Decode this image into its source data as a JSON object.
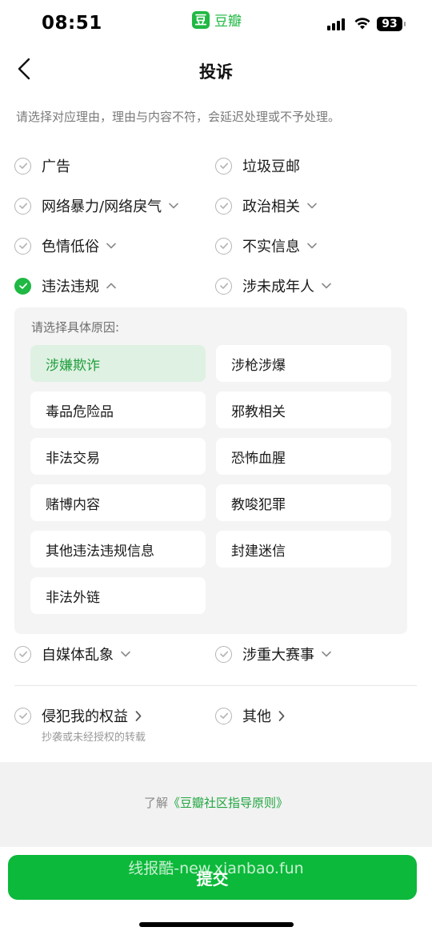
{
  "status_bar": {
    "time": "08:51",
    "app_logo": "豆",
    "app_name": "豆瓣",
    "battery": "93"
  },
  "header": {
    "title": "投诉"
  },
  "instruction": "请选择对应理由，理由与内容不符，会延迟处理或不予处理。",
  "reasons": [
    {
      "label": "广告",
      "checked": false,
      "arrow": "none"
    },
    {
      "label": "垃圾豆邮",
      "checked": false,
      "arrow": "none"
    },
    {
      "label": "网络暴力/网络戾气",
      "checked": false,
      "arrow": "down"
    },
    {
      "label": "政治相关",
      "checked": false,
      "arrow": "down"
    },
    {
      "label": "色情低俗",
      "checked": false,
      "arrow": "down"
    },
    {
      "label": "不实信息",
      "checked": false,
      "arrow": "down"
    },
    {
      "label": "违法违规",
      "checked": true,
      "arrow": "up"
    },
    {
      "label": "涉未成年人",
      "checked": false,
      "arrow": "down"
    },
    {
      "label": "自媒体乱象",
      "checked": false,
      "arrow": "down"
    },
    {
      "label": "涉重大赛事",
      "checked": false,
      "arrow": "down"
    },
    {
      "label": "侵犯我的权益",
      "checked": false,
      "arrow": "right"
    },
    {
      "label": "其他",
      "checked": false,
      "arrow": "right"
    }
  ],
  "sub_reasons": {
    "title": "请选择具体原因:",
    "items": [
      {
        "label": "涉嫌欺诈",
        "selected": true
      },
      {
        "label": "涉枪涉爆",
        "selected": false
      },
      {
        "label": "毒品危险品",
        "selected": false
      },
      {
        "label": "邪教相关",
        "selected": false
      },
      {
        "label": "非法交易",
        "selected": false
      },
      {
        "label": "恐怖血腥",
        "selected": false
      },
      {
        "label": "赌博内容",
        "selected": false
      },
      {
        "label": "教唆犯罪",
        "selected": false
      },
      {
        "label": "其他违法违规信息",
        "selected": false
      },
      {
        "label": "封建迷信",
        "selected": false
      },
      {
        "label": "非法外链",
        "selected": false
      }
    ]
  },
  "rights_hint": "抄袭或未经授权的转载",
  "guide": {
    "prefix": "了解",
    "link": "《豆瓣社区指导原则》"
  },
  "submit_label": "提交",
  "watermark": "线报酷-new.xianbao.fun",
  "colors": {
    "accent": "#1fb843",
    "submit": "#0cb93a",
    "chip_selected_bg": "#dff1e2",
    "chip_selected_text": "#1e9e3c"
  }
}
